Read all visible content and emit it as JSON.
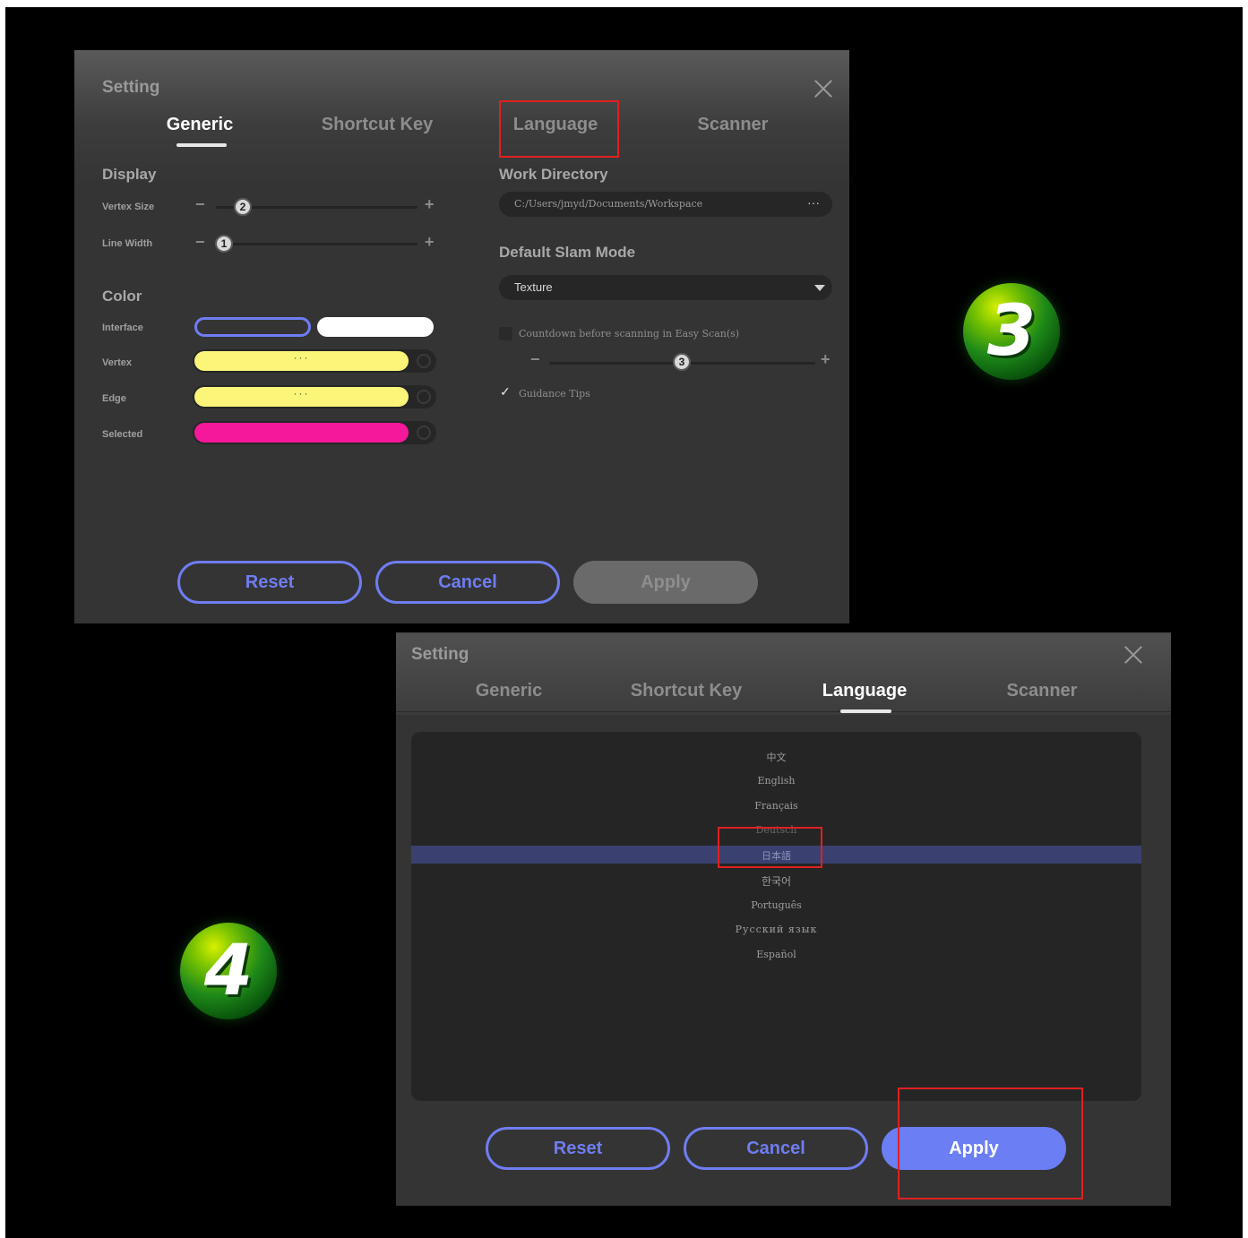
{
  "panel3": {
    "title": "Setting",
    "tabs": [
      "Generic",
      "Shortcut Key",
      "Language",
      "Scanner"
    ],
    "active_tab": "Generic",
    "display": {
      "heading": "Display",
      "vertex_size_label": "Vertex Size",
      "vertex_size_value": "2",
      "line_width_label": "Line Width",
      "line_width_value": "1",
      "minus": "−",
      "plus": "+"
    },
    "color": {
      "heading": "Color",
      "interface_label": "Interface",
      "vertex_label": "Vertex",
      "edge_label": "Edge",
      "selected_label": "Selected",
      "more": "···",
      "vertex_color": "#fbf57a",
      "edge_color": "#fbf57a",
      "selected_color": "#f5189a"
    },
    "work_directory": {
      "heading": "Work Directory",
      "path": "C:/Users/jmyd/Documents/Workspace",
      "more": "···"
    },
    "slam": {
      "heading": "Default Slam Mode",
      "value": "Texture"
    },
    "countdown": {
      "label": "Countdown before scanning in Easy Scan(s)",
      "checked": false,
      "value": "3"
    },
    "guidance": {
      "label": "Guidance Tips",
      "checked": true,
      "check": "✓"
    },
    "buttons": {
      "reset": "Reset",
      "cancel": "Cancel",
      "apply": "Apply"
    }
  },
  "panel4": {
    "title": "Setting",
    "tabs": [
      "Generic",
      "Shortcut Key",
      "Language",
      "Scanner"
    ],
    "active_tab": "Language",
    "languages": [
      "中文",
      "English",
      "Français",
      "Deutsch",
      "日本語",
      "한국어",
      "Português",
      "Русский язык",
      "Español"
    ],
    "selected_language": "日本語",
    "buttons": {
      "reset": "Reset",
      "cancel": "Cancel",
      "apply": "Apply"
    }
  },
  "badges": {
    "step3": "3",
    "step4": "4"
  },
  "colors": {
    "accent": "#6f7df2",
    "highlight": "#e02020"
  }
}
